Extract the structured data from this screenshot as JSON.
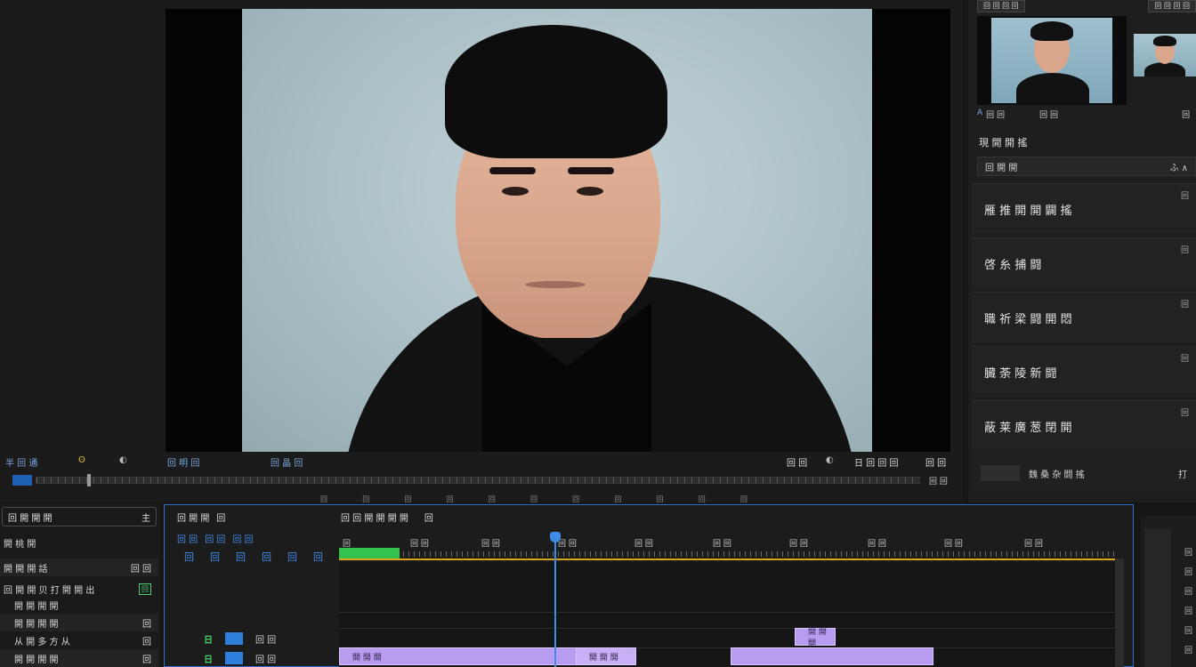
{
  "monitor": {
    "controls": {
      "left_label": "半 回 通",
      "mid_label": "回 明 回",
      "mid2_label": "回 晶 回",
      "right_label": "回 回",
      "far_right_label": "日 回 回 回",
      "end_label": "回 回"
    },
    "scrubber_end_label": "回 回",
    "ruler_labels": [
      "回",
      "回",
      "回",
      "回",
      "回",
      "回",
      "回",
      "回",
      "回",
      "回",
      "回"
    ]
  },
  "right_panel": {
    "tab_left": "回 回 回 回",
    "tab_right": "回 回 回 回",
    "meta_left": "回 回",
    "meta_mid": "回 回",
    "meta_right": "回",
    "section_title": "現 開 開 搖",
    "select_value": "回 開 開",
    "select_right": "ふ ∧",
    "items": [
      {
        "label": "雁 推 開 開 闢 搖",
        "corner": "回"
      },
      {
        "label": "啓 糸 捕 闘",
        "corner": "回"
      },
      {
        "label": "職 祈 梁 闘 開 悶",
        "corner": "回"
      },
      {
        "label": "臓 荼 陵 新 闘",
        "corner": "回"
      },
      {
        "label": "蔽 莱 廣 葱 閉 開",
        "corner": "回"
      }
    ],
    "footer_label": "魏 桑 杂 闘 搖",
    "footer_corner": "打"
  },
  "project": {
    "search_label": "回 開 開 開",
    "search_right": "主",
    "rows": [
      {
        "left": "開 桃 開",
        "right": ""
      },
      {
        "left": "開 開 開 話",
        "right": "回 回"
      },
      {
        "left": "回 開 開 贝 打 開 開 出",
        "right": "回",
        "badge": "回"
      },
      {
        "left": "開 開 開 開",
        "right": ""
      },
      {
        "left": "開 開 開 開",
        "right": "回"
      },
      {
        "left": "从 開 多 方 从",
        "right": "回"
      },
      {
        "left": "開 開 開 開",
        "right": "回"
      }
    ]
  },
  "timeline": {
    "header_left": [
      "回 開 開",
      "回"
    ],
    "header_seq": [
      "回 回 開 開 開 開",
      "回"
    ],
    "tools": [
      "回 回",
      "回 回",
      "回 回"
    ],
    "tools2": [
      "回",
      "回",
      "回",
      "回",
      "回",
      "回"
    ],
    "tick_labels": [
      "回",
      "回 回",
      "回 回",
      "回 回",
      "回 回",
      "回 回",
      "回 回",
      "回 回",
      "回 回",
      "回 回"
    ],
    "track_heads": [
      {
        "label": "回 回",
        "icon": "日"
      },
      {
        "label": "回 回",
        "icon": "日"
      }
    ],
    "clips": [
      {
        "label": "開 開 開"
      },
      {
        "label": "開 開 開"
      },
      {
        "label": "開 開 開"
      },
      {
        "label": ""
      }
    ]
  },
  "audio_meter": {
    "labels": [
      "回",
      "回",
      "回",
      "回",
      "回",
      "回"
    ]
  }
}
